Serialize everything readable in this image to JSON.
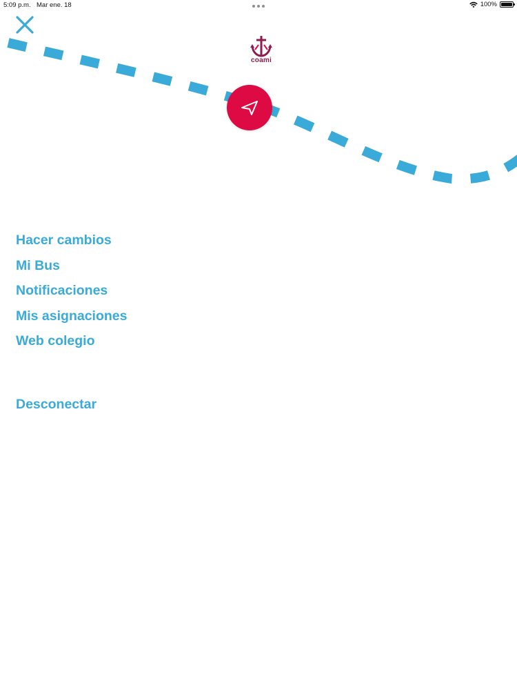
{
  "status_bar": {
    "time": "5:09 p.m.",
    "date": "Mar ene. 18",
    "battery": "100%",
    "battery_level": 1.0,
    "icons": [
      "more-dots-icon",
      "wifi-icon",
      "battery-icon"
    ]
  },
  "header": {
    "close_icon": "close-icon",
    "logo_text": "coami",
    "logo_icon": "anchor-cross-icon",
    "location_icon": "navigation-arrow-icon"
  },
  "menu": {
    "items": [
      {
        "label": "Hacer cambios"
      },
      {
        "label": "Mi Bus"
      },
      {
        "label": "Notificaciones"
      },
      {
        "label": "Mis asignaciones"
      },
      {
        "label": "Web colegio"
      }
    ],
    "logout_label": "Desconectar"
  },
  "colors": {
    "accent_blue": "#3aaad8",
    "route_blue": "#3aaad8",
    "location_red": "#dd0a44",
    "logo_purple": "#8c1d4e"
  }
}
